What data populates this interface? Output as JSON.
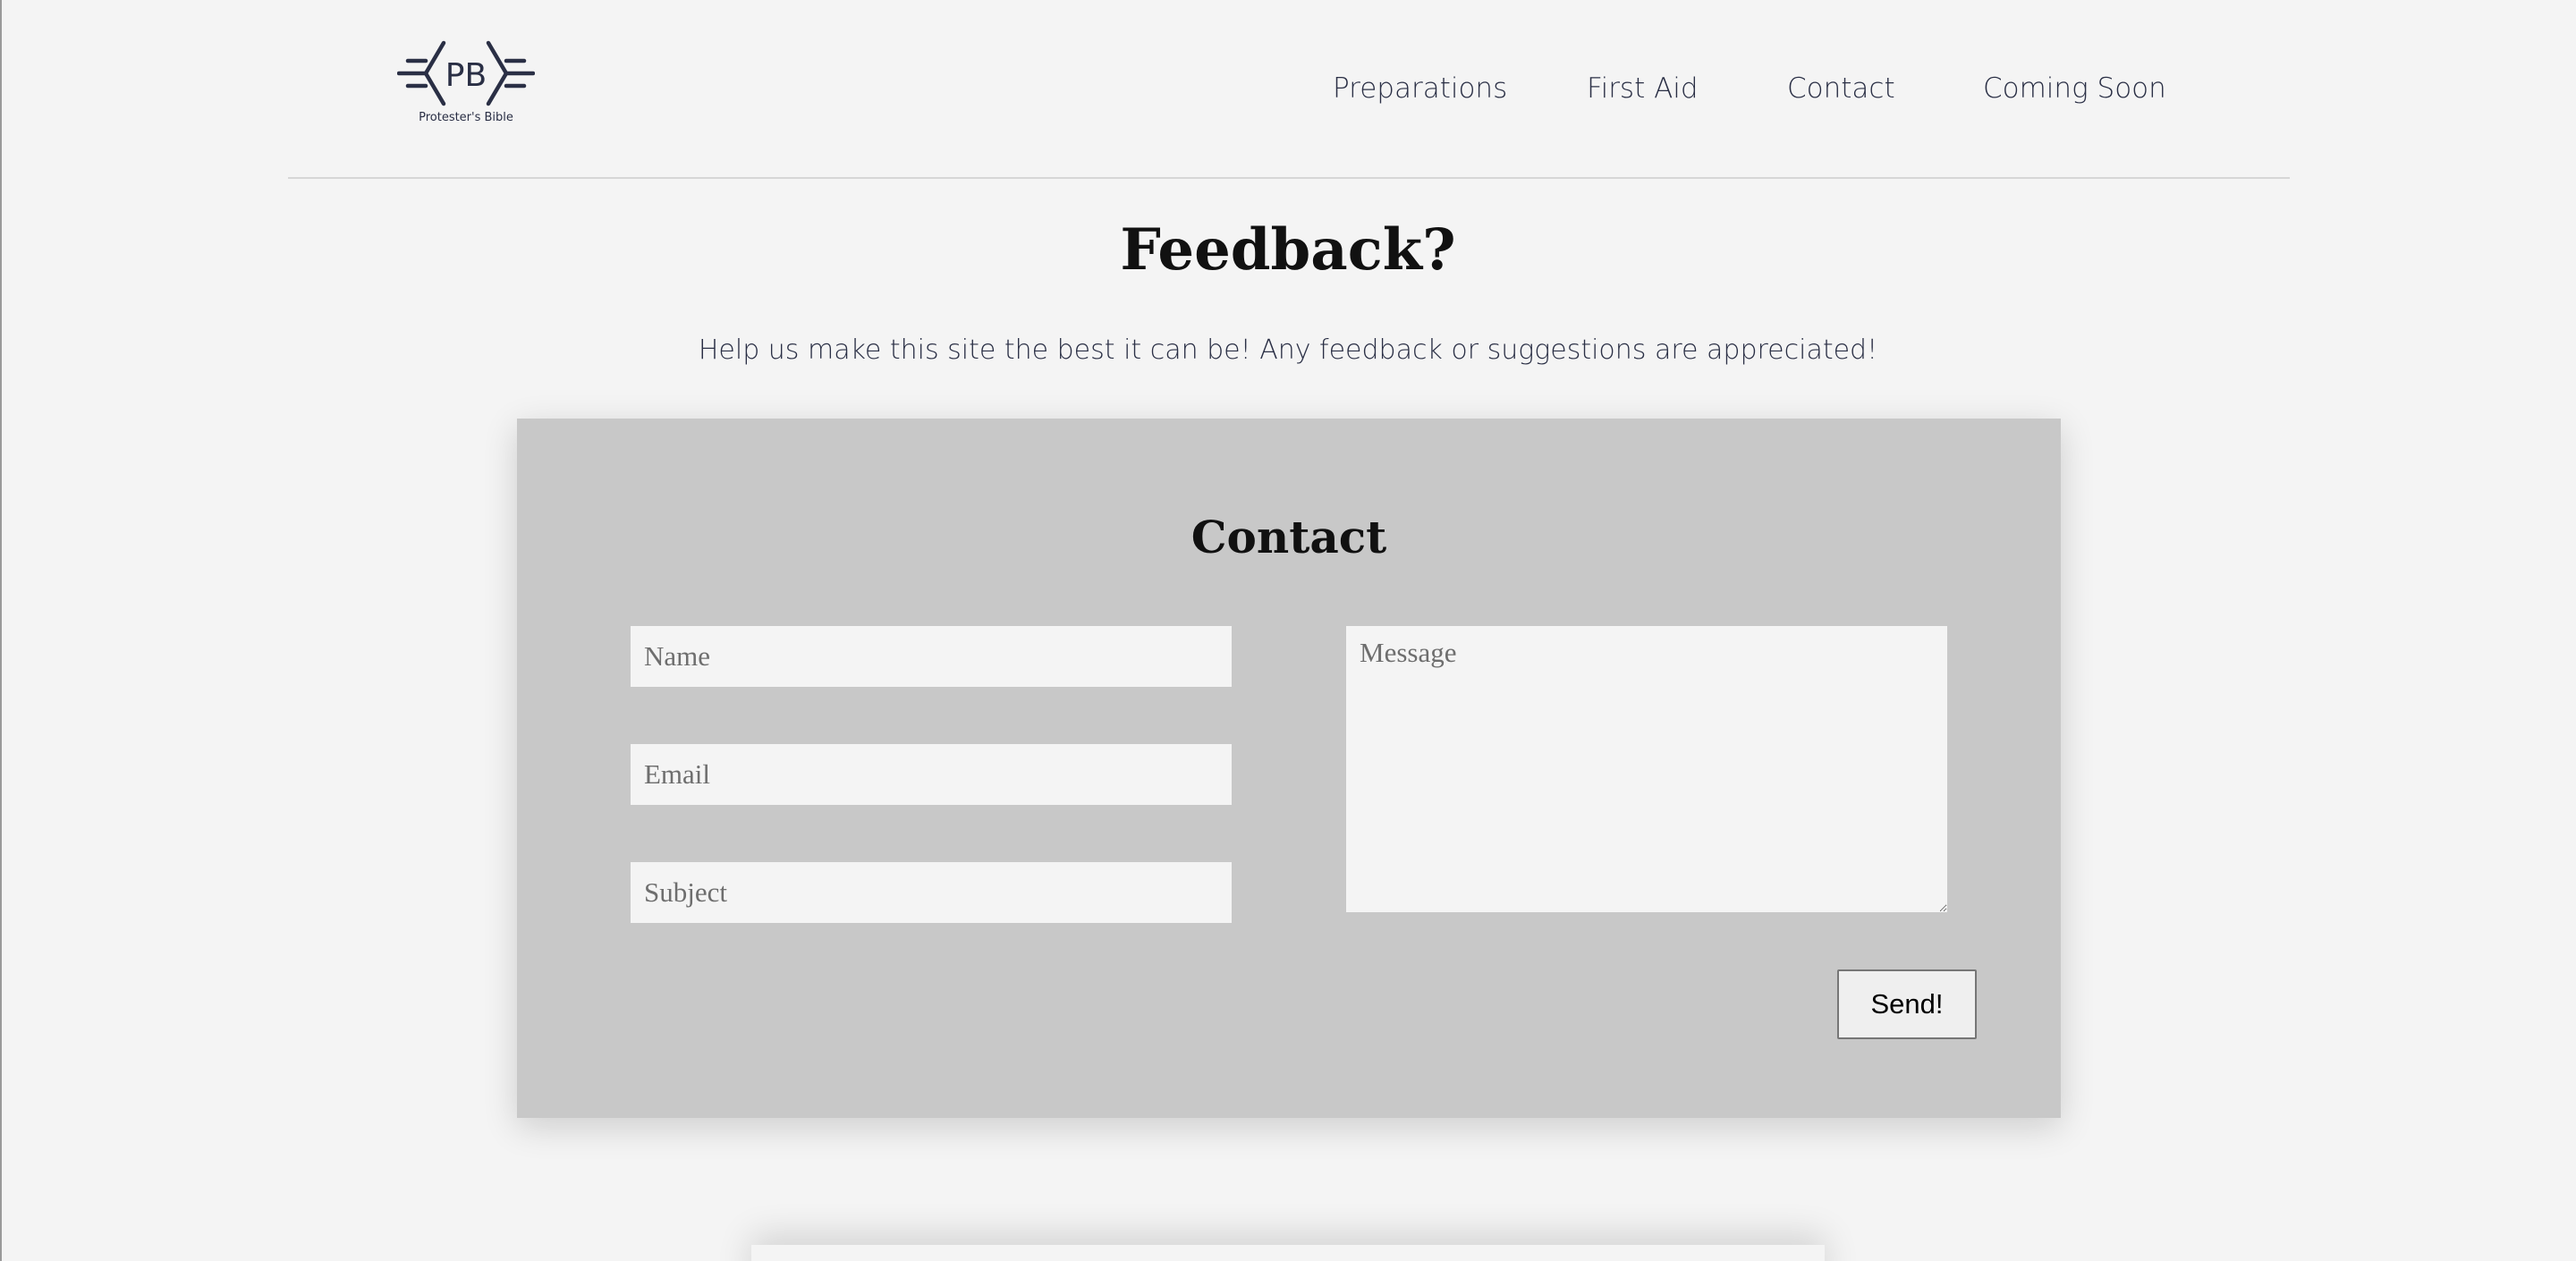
{
  "header": {
    "logo": {
      "icon": "pb-logo-icon",
      "monogram": "PB",
      "caption": "Protester's Bible",
      "color": "#2a2f45"
    },
    "nav": [
      {
        "label": "Preparations"
      },
      {
        "label": "First Aid"
      },
      {
        "label": "Contact"
      },
      {
        "label": "Coming Soon"
      }
    ]
  },
  "feedback": {
    "title": "Feedback?",
    "subtitle": "Help us make this site the best it can be! Any feedback or suggestions are appreciated!"
  },
  "contact_form": {
    "title": "Contact",
    "name_placeholder": "Name",
    "email_placeholder": "Email",
    "subject_placeholder": "Subject",
    "message_placeholder": "Message",
    "send_label": "Send!"
  },
  "colors": {
    "page_background": "#f4f4f4",
    "card_background": "#c8c8c8",
    "text_primary": "#2a2f45"
  }
}
